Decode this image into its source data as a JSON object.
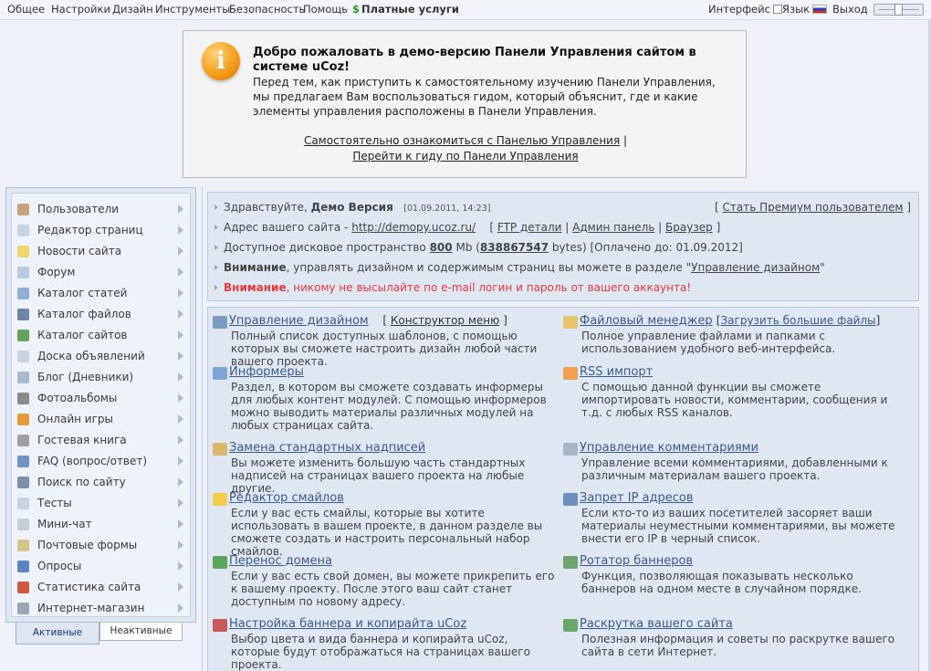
{
  "topbar": {
    "menu": [
      "Общее",
      "Настройки",
      "Дизайн",
      "Инструменты",
      "Безопасность",
      "Помощь"
    ],
    "paid_symbol": "$",
    "paid": "Платные услуги",
    "interface": "Интерфейс",
    "language": "Язык",
    "logout": "Выход"
  },
  "welcome": {
    "icon_glyph": "i",
    "title": "Добро пожаловать в демо-версию Панели Управления сайтом в системе uCoz!",
    "text": "Перед тем, как приступить к самостоятельному изучению Панели Управления, мы предлагаем Вам воспользоваться гидом, который объяснит, где и какие элементы управления расположены в Панели Управления.",
    "link_self": "Самостоятельно ознакомиться с Панелью Управления",
    "separator": "|",
    "link_guide": "Перейти к гиду по Панели Управления"
  },
  "sidebar": {
    "items": [
      {
        "label": "Пользователи",
        "icon": "users-icon",
        "color": "#c9a27a"
      },
      {
        "label": "Редактор страниц",
        "icon": "page-icon",
        "color": "#c8d4e6"
      },
      {
        "label": "Новости сайта",
        "icon": "bulb-icon",
        "color": "#f0d36a"
      },
      {
        "label": "Форум",
        "icon": "chat-icon",
        "color": "#b9c9df"
      },
      {
        "label": "Каталог статей",
        "icon": "articles-icon",
        "color": "#8fb0d6"
      },
      {
        "label": "Каталог файлов",
        "icon": "files-icon",
        "color": "#6e86a6"
      },
      {
        "label": "Каталог сайтов",
        "icon": "globe-icon",
        "color": "#63a35c"
      },
      {
        "label": "Доска объявлений",
        "icon": "board-icon",
        "color": "#c9d3e0"
      },
      {
        "label": "Блог (Дневники)",
        "icon": "blog-icon",
        "color": "#a9b9cf"
      },
      {
        "label": "Фотоальбомы",
        "icon": "camera-icon",
        "color": "#8a8a8a"
      },
      {
        "label": "Онлайн игры",
        "icon": "games-icon",
        "color": "#e59a3b"
      },
      {
        "label": "Гостевая книга",
        "icon": "guestbook-icon",
        "color": "#a0a0a0"
      },
      {
        "label": "FAQ (вопрос/ответ)",
        "icon": "question-icon",
        "color": "#6f93c4"
      },
      {
        "label": "Поиск по сайту",
        "icon": "search-icon",
        "color": "#7d8fa8"
      },
      {
        "label": "Тесты",
        "icon": "tests-icon",
        "color": "#c9d3e0"
      },
      {
        "label": "Мини-чат",
        "icon": "minichat-icon",
        "color": "#c7cdd6"
      },
      {
        "label": "Почтовые формы",
        "icon": "mail-icon",
        "color": "#d7c48a"
      },
      {
        "label": "Опросы",
        "icon": "polls-icon",
        "color": "#5b84c2"
      },
      {
        "label": "Статистика сайта",
        "icon": "stats-icon",
        "color": "#d2573d"
      },
      {
        "label": "Интернет-магазин",
        "icon": "shop-icon",
        "color": "#9aa6b6"
      }
    ],
    "tab_active": "Активные",
    "tab_inactive": "Неактивные"
  },
  "info": {
    "hello": "Здравствуйте,",
    "user": "Демо Версия",
    "date": "[01.09.2011, 14:23]",
    "premium_pre": "[",
    "premium_link": "Стать Премиум пользователем",
    "premium_post": "]",
    "address_label": "Адрес вашего сайта -",
    "address_url": "http://demopy.ucoz.ru/",
    "bracket_open": "[",
    "ftp": "FTP детали",
    "sep": "|",
    "admin": "Админ панель",
    "browser": "Браузер",
    "bracket_close": "]",
    "disk_label": "Доступное дисковое пространство",
    "disk_mb": "800",
    "disk_mb_unit": "Mb (",
    "disk_bytes": "838867547",
    "disk_rest": "bytes) [Оплачено до: 01.09.2012]",
    "attention": "Внимание",
    "design_note": ", управлять дизайном и содержимым страниц вы можете в разделе \"",
    "design_link": "Управление дизайном",
    "design_close": "\"",
    "warn_rest": ", никому не высылайте по e-mail логин и пароль от вашего аккаунта!"
  },
  "tools": [
    {
      "title": "Управление дизайном",
      "extra_pre": "[",
      "extra_link": "Конструктор меню",
      "extra_post": "]",
      "desc": "Полный список доступных шаблонов, с помощью которых вы сможете настроить дизайн любой части вашего проекта.",
      "icon": "design-icon",
      "color": "#7d9bc5"
    },
    {
      "title": "Файловый менеджер",
      "extra_pre": "[",
      "extra_link": "Загрузить большие файлы",
      "extra_post": "]",
      "desc": "Полное управление файлами и папками с использованием удобного веб-интерфейса.",
      "icon": "folder-icon",
      "color": "#e6c46b"
    },
    {
      "title": "Информеры",
      "desc": "Раздел, в котором вы сможете создавать информеры для любых контент модулей. С помощью информеров можно выводить материалы различных модулей на любых страницах сайта.",
      "icon": "informers-icon",
      "color": "#7da6d6"
    },
    {
      "title": "RSS импорт",
      "desc": "С помощью данной функции вы сможете импортировать новости, комментарии, сообщения и т.д. с любых RSS каналов.",
      "icon": "rss-icon",
      "color": "#f0a050"
    },
    {
      "title": "Замена стандартных надписей",
      "desc": "Вы можете изменить большую часть стандартных надписей на страницах вашего проекта на любые другие.",
      "icon": "labels-icon",
      "color": "#d9b86b"
    },
    {
      "title": "Управление комментариями",
      "desc": "Управление всеми комментариями, добавленными к различным материалам вашего проекта.",
      "icon": "comments-icon",
      "color": "#a8b6c8"
    },
    {
      "title": "Редактор смайлов",
      "desc": "Если у вас есть смайлы, которые вы хотите использовать в вашем проекте, в данном разделе вы сможете создать и настроить персональный набор смайлов.",
      "icon": "smiley-icon",
      "color": "#f2cf4a"
    },
    {
      "title": "Запрет IP адресов",
      "desc": "Если кто-то из ваших посетителей засоряет ваши материалы неуместными комментариями, вы можете внести его IP в черный список.",
      "icon": "ban-ip-icon",
      "color": "#6d8fc0"
    },
    {
      "title": "Перенос домена",
      "desc": "Если у вас есть свой домен, вы можете прикрепить его к вашему проекту. После этого ваш сайт станет доступным по новому адресу.",
      "icon": "domain-icon",
      "color": "#5aa85a"
    },
    {
      "title": "Ротатор баннеров",
      "desc": "Функция, позволяющая показывать несколько баннеров на одном месте в случайном порядке.",
      "icon": "banners-icon",
      "color": "#6fa36f"
    },
    {
      "title": "Настройка баннера и копирайта uCoz",
      "desc": "Выбор цвета и вида баннера и копирайта uCoz, которые будут отображаться на страницах вашего проекта.",
      "icon": "banner-settings-icon",
      "color": "#c75a5a"
    },
    {
      "title": "Раскрутка вашего сайта",
      "desc": "Полезная информация и советы по раскрутке вашего сайта в сети Интернет.",
      "icon": "promotion-icon",
      "color": "#6aa86a"
    }
  ]
}
